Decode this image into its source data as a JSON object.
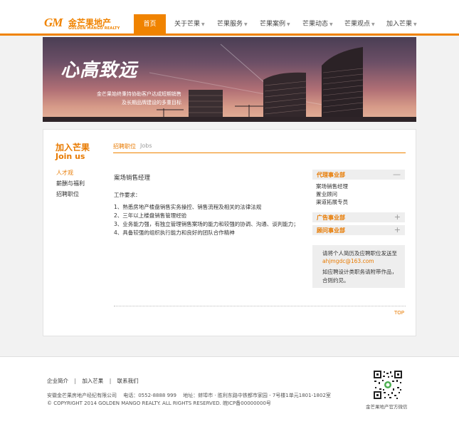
{
  "brand": {
    "mark": "GM",
    "name_cn": "金芒果地产",
    "name_en": "GOLDEN MANGO REALTY",
    "accent": "#f08300"
  },
  "nav": {
    "items": [
      {
        "label": "首页",
        "active": true
      },
      {
        "label": "关于芒果"
      },
      {
        "label": "芒果服务"
      },
      {
        "label": "芒果案例"
      },
      {
        "label": "芒果动态"
      },
      {
        "label": "芒果观点"
      },
      {
        "label": "加入芒果"
      }
    ]
  },
  "banner": {
    "slogan": "心高致远",
    "line1": "金芒果始终秉持协助客户达成短期销售",
    "line2": "及长期品牌建设的多重目标"
  },
  "sidebar": {
    "title_cn": "加入芒果",
    "title_en": "Join us",
    "links": [
      {
        "label": "人才观",
        "active": true
      },
      {
        "label": "薪酬与福利"
      },
      {
        "label": "招聘职位"
      }
    ]
  },
  "tab": {
    "cn": "招聘职位",
    "en": "Jobs"
  },
  "job": {
    "title": "案场销售经理",
    "requirements_label": "工作要求：",
    "requirements": [
      "1、熟悉房地产楼盘销售实务操控、销售流程及相关的法律法规",
      "2、三年以上楼盘销售管理经验",
      "3、业务能力强，有独立管理销售案场的能力和较强的协调、沟通、谈判能力；",
      "4、具备较强的组织执行能力和良好的团队合作精神"
    ]
  },
  "departments": [
    {
      "label": "代理事业部",
      "toggle": "—",
      "expanded": true,
      "subs": [
        "案场销售经理",
        "置业顾问",
        "渠道拓展专员"
      ]
    },
    {
      "label": "广告事业部",
      "toggle": "+"
    },
    {
      "label": "顾问事业部",
      "toggle": "+"
    }
  ],
  "apply": {
    "line1": "请将个人简历及应聘职位发送至",
    "email": "ahjmgdc@163.com",
    "line3": "如应聘设计类职务请附带作品，",
    "line4": "合则约见。"
  },
  "top_link": "TOP",
  "footer": {
    "links": [
      "企业简介",
      "加入芒果",
      "联系我们"
    ],
    "separator": "|",
    "info": "安徽金芒果房地产经纪有限公司　 电话：0552-8888 999　 地址：蚌埠市 · 胜利东路中铁都市家园 - 7号楼1单元1801-1802室",
    "copyright": "© COPYRIGHT  2014  GOLDEN MANGO REALTY.  ALL RIGHTS RESERVED.  皖ICP备00000000号",
    "qr_caption": "金芒果地产官方微信"
  }
}
